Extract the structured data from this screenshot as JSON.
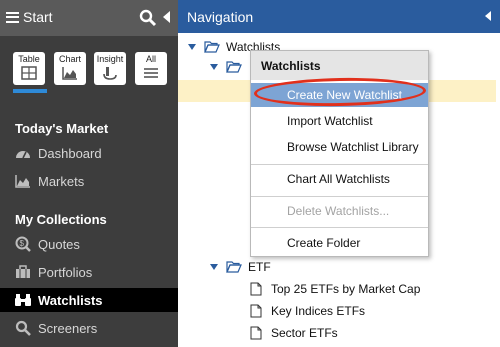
{
  "sidebar": {
    "start_label": "Start",
    "views": [
      {
        "label": "Table"
      },
      {
        "label": "Chart"
      },
      {
        "label": "Insight"
      },
      {
        "label": "All"
      }
    ],
    "sections": [
      {
        "title": "Today's Market"
      },
      {
        "title": "My Collections"
      }
    ],
    "items": [
      {
        "label": "Dashboard",
        "icon": "gauge-icon"
      },
      {
        "label": "Markets",
        "icon": "area-chart-icon"
      },
      {
        "label": "Quotes",
        "icon": "dollar-search-icon"
      },
      {
        "label": "Portfolios",
        "icon": "briefcase-icon"
      },
      {
        "label": "Watchlists",
        "icon": "binoculars-icon"
      },
      {
        "label": "Screeners",
        "icon": "magnifier-icon"
      }
    ],
    "active_item": "Watchlists"
  },
  "navigation": {
    "title": "Navigation",
    "tree": {
      "root": "Watchlists",
      "etf_folder": "ETF",
      "etf_items": [
        "Top 25 ETFs by Market Cap",
        "Key Indices ETFs",
        "Sector ETFs"
      ]
    }
  },
  "context_menu": {
    "header": "Watchlists",
    "items": [
      {
        "label": "Create New Watchlist",
        "state": "selected"
      },
      {
        "label": "Import Watchlist",
        "state": "normal"
      },
      {
        "label": "Browse Watchlist Library",
        "state": "normal"
      },
      {
        "label": "Chart All Watchlists",
        "state": "normal"
      },
      {
        "label": "Delete Watchlists...",
        "state": "disabled"
      },
      {
        "label": "Create Folder",
        "state": "normal"
      }
    ]
  },
  "colors": {
    "nav_header": "#2a5c9e",
    "sidebar_bg": "#3d3d3d",
    "selection": "#7da4d4",
    "highlight_row": "#fdf1c6",
    "annotation": "#e1301c"
  }
}
